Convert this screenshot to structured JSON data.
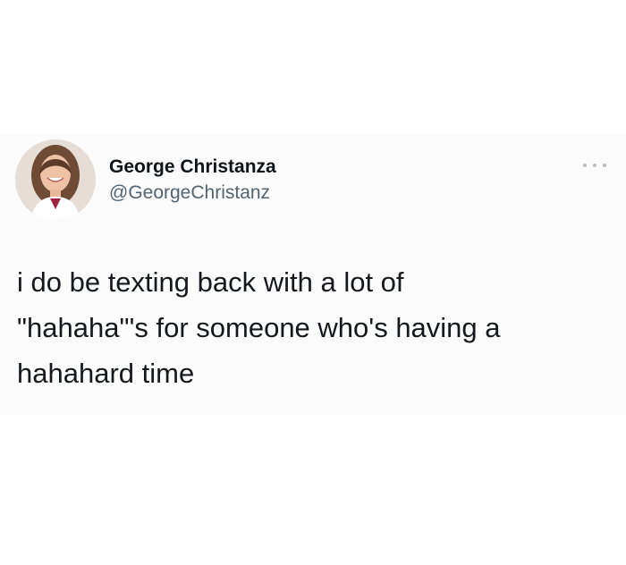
{
  "tweet": {
    "author": {
      "display_name": "George Christanza",
      "handle": "@GeorgeChristanz",
      "avatar_icon": "profile-photo"
    },
    "more_icon": "ellipsis-icon",
    "text_lines": [
      "i do be texting back with a lot of",
      "\"hahaha\"'s for someone who's having a",
      "hahahard time"
    ]
  }
}
